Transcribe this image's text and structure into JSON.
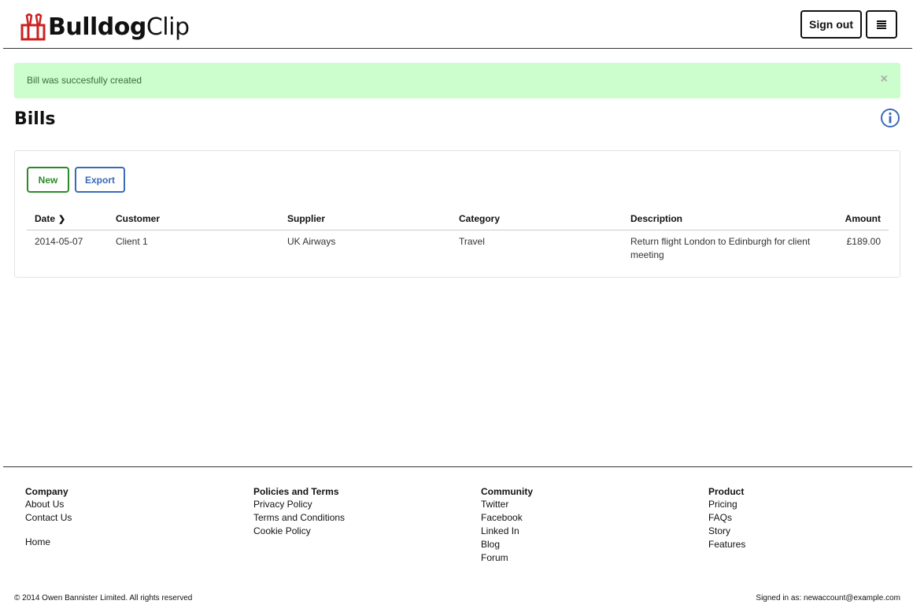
{
  "brand": {
    "name_bold": "Bulldog",
    "name_light": "Clip",
    "logo_icon": "bulldog-clip-icon",
    "logo_color": "#cc2020"
  },
  "header": {
    "signout_label": "Sign out",
    "menu_icon": "hamburger-menu-icon"
  },
  "alert": {
    "message": "Bill was succesfully created",
    "close_label": "×"
  },
  "page": {
    "title": "Bills",
    "info_icon": "info-circle-icon"
  },
  "toolbar": {
    "new_label": "New",
    "export_label": "Export"
  },
  "table": {
    "headers": {
      "date": "Date",
      "customer": "Customer",
      "supplier": "Supplier",
      "category": "Category",
      "description": "Description",
      "amount": "Amount"
    },
    "sort_indicator": "chevron-down-icon",
    "rows": [
      {
        "date": "2014-05-07",
        "customer": "Client 1",
        "supplier": "UK Airways",
        "category": "Travel",
        "description": "Return flight London to Edinburgh for client meeting",
        "amount": "£189.00"
      }
    ]
  },
  "footer": {
    "company": {
      "title": "Company",
      "links": [
        "About Us",
        "Contact Us"
      ],
      "home": "Home"
    },
    "policies": {
      "title": "Policies and Terms",
      "links": [
        "Privacy Policy",
        "Terms and Conditions",
        "Cookie Policy"
      ]
    },
    "community": {
      "title": "Community",
      "links": [
        "Twitter",
        "Facebook",
        "Linked In",
        "Blog",
        "Forum"
      ]
    },
    "product": {
      "title": "Product",
      "links": [
        "Pricing",
        "FAQs",
        "Story",
        "Features"
      ]
    },
    "copyright": "© 2014 Owen Bannister Limited. All rights reserved",
    "signed_in": "Signed in as: newaccount@example.com"
  },
  "colors": {
    "alert_bg": "#ccfdcc",
    "new_green": "#2a8a2a",
    "export_blue": "#3a6ab8",
    "info_blue": "#3a6ab8"
  }
}
